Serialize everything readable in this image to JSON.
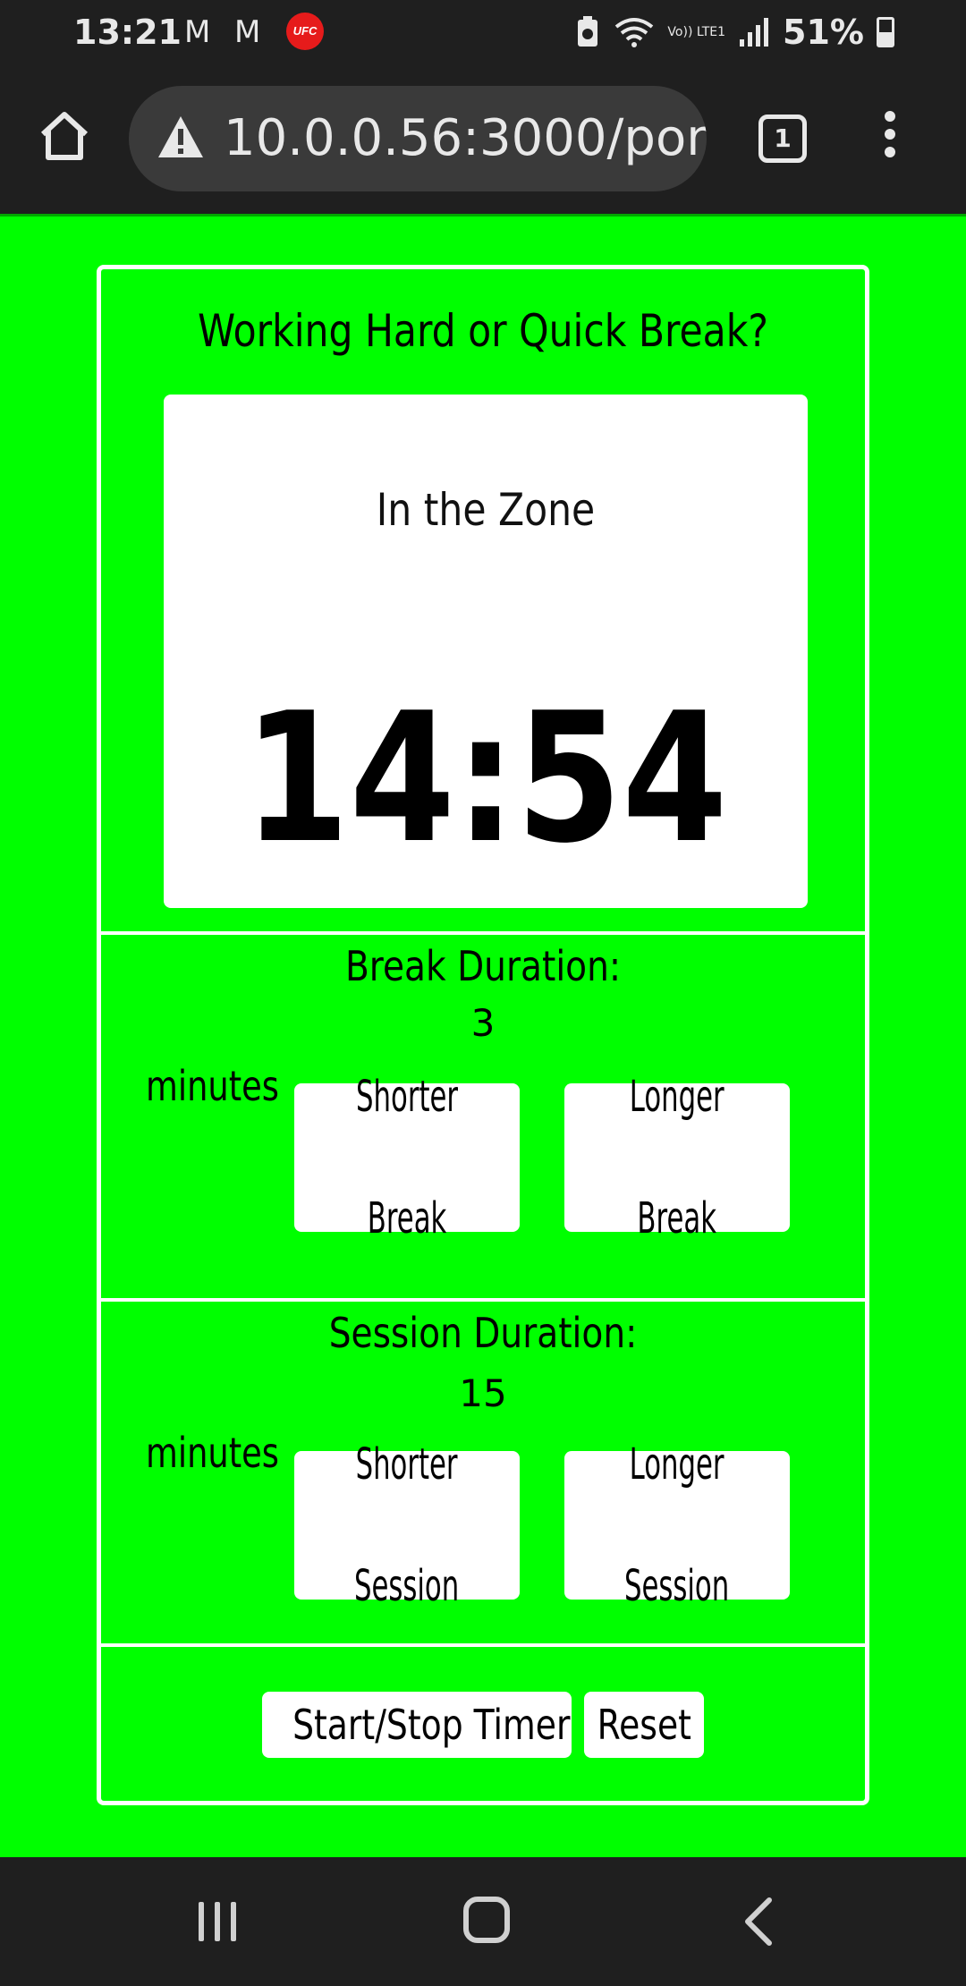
{
  "status_bar": {
    "time": "13:21",
    "mail_icons": [
      "M",
      "M"
    ],
    "ufc_badge": "UFC",
    "network_label": "Vo)) LTE1",
    "battery": "51%"
  },
  "browser": {
    "url": "10.0.0.56:3000/pom",
    "tab_count": "1"
  },
  "app": {
    "title": "Working Hard or Quick Break?",
    "timer": {
      "label": "In the Zone",
      "value": "14:54"
    },
    "break": {
      "title": "Break Duration:",
      "value": "3",
      "unit": "minutes",
      "shorter_label_line1": "Shorter",
      "shorter_label_line2": "Break",
      "longer_label_line1": "Longer",
      "longer_label_line2": "Break"
    },
    "session": {
      "title": "Session Duration:",
      "value": "15",
      "unit": "minutes",
      "shorter_label_line1": "Shorter",
      "shorter_label_line2": "Session",
      "longer_label_line1": "Longer",
      "longer_label_line2": "Session"
    },
    "controls": {
      "start_stop_label": "Start/Stop Timer",
      "reset_label": "Reset"
    }
  },
  "colors": {
    "background": "#00ff00",
    "panel": "#ffffff",
    "system_bar": "#1f1f1f"
  }
}
